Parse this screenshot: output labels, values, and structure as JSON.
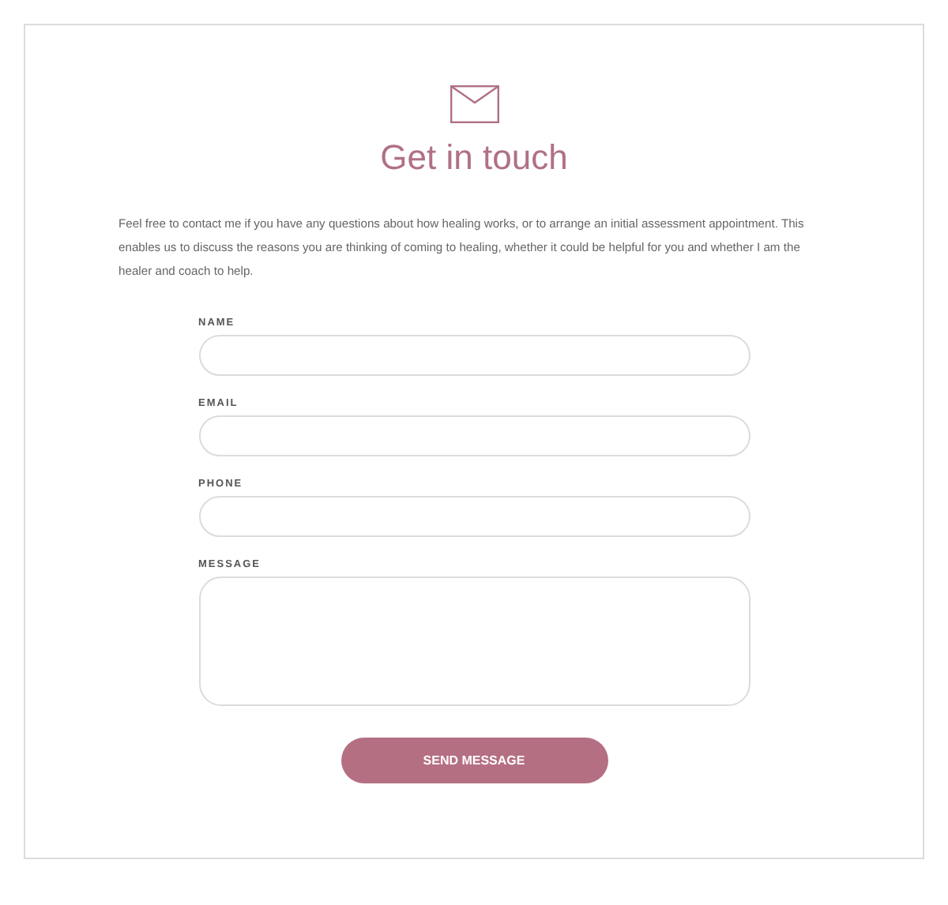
{
  "title": "Get in touch",
  "intro": "Feel free to contact me if you have any questions about how healing works, or to arrange an initial assessment appointment. This enables us to discuss the reasons you are thinking of coming to healing, whether it could be helpful for you and whether I am the healer and coach to help.",
  "fields": [
    {
      "label": "NAME",
      "kind": "line"
    },
    {
      "label": "EMAIL",
      "kind": "line"
    },
    {
      "label": "PHONE",
      "kind": "line"
    },
    {
      "label": "MESSAGE",
      "kind": "area"
    }
  ],
  "submit": "SEND MESSAGE"
}
